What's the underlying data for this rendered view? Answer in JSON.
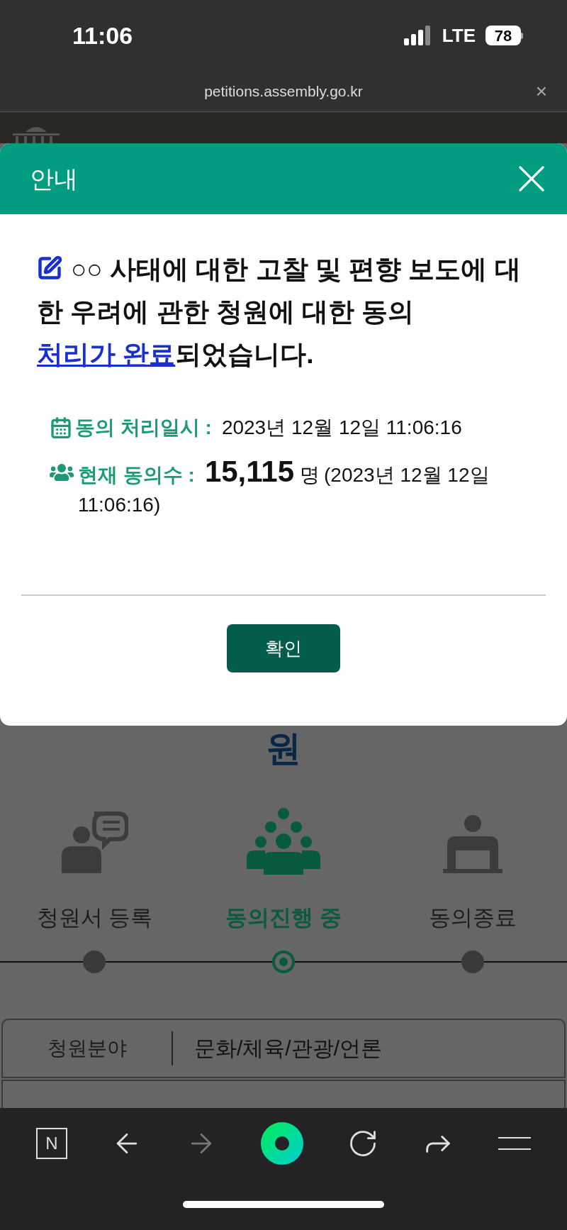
{
  "status_bar": {
    "time": "11:06",
    "network": "LTE",
    "battery": "78"
  },
  "browser": {
    "url": "petitions.assembly.go.kr",
    "close": "×"
  },
  "dialog": {
    "title": "안내",
    "message": "○○ 사태에 대한 고찰 및 편향 보도에 대한 우려에 관한 청원에 대한 동의 ",
    "message_link": "처리가 완료",
    "message_end": "되었습니다.",
    "info": [
      {
        "kind": "calendar",
        "label": "동의 처리일시 :",
        "value": "2023년 12월 12일 11:06:16"
      },
      {
        "kind": "people",
        "label": "현재 동의수 :",
        "count": "15,115",
        "unit": "명",
        "value": "(2023년 12월 12일 11:06:16)"
      }
    ],
    "button": "확인"
  },
  "page": {
    "heading": "원",
    "steps": [
      {
        "kind": "speaker",
        "label": "청원서 등록",
        "selected": false
      },
      {
        "kind": "crowd",
        "label": "동의진행 중",
        "selected": true
      },
      {
        "kind": "podium",
        "label": "동의종료",
        "selected": false
      }
    ],
    "table": [
      {
        "label": "청원분야",
        "value": "문화/체육/관광/언론"
      }
    ]
  },
  "toolbar": {
    "logo": "N",
    "forward_disabled": true
  }
}
